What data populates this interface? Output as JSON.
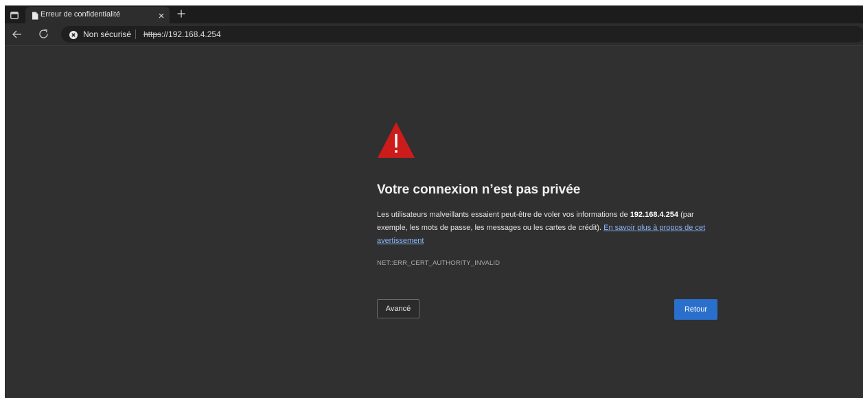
{
  "tab": {
    "title": "Erreur de confidentialité"
  },
  "toolbar": {
    "security_label": "Non sécurisé",
    "url_scheme": "https",
    "url_rest": "://192.168.4.254"
  },
  "page": {
    "heading": "Votre connexion n’est pas privée",
    "desc_before": "Les utilisateurs malveillants essaient peut-être de voler vos informations de ",
    "desc_host": "192.168.4.254",
    "desc_after": " (par exemple, les mots de passe, les messages ou les cartes de crédit). ",
    "learn_more": "En savoir plus à propos de cet avertissement",
    "error_code": "NET::ERR_CERT_AUTHORITY_INVALID",
    "advanced_button": "Avancé",
    "back_button": "Retour"
  },
  "icons": {
    "window": "window-icon",
    "favicon": "page-icon",
    "close": "close-icon",
    "new_tab": "plus-icon",
    "back": "back-arrow-icon",
    "reload": "reload-icon",
    "security": "not-secure-icon",
    "warning": "warning-triangle-icon"
  },
  "colors": {
    "warning_red": "#cc1b1b",
    "link_blue": "#8ab4f8",
    "primary_button": "#2a6fcb"
  }
}
